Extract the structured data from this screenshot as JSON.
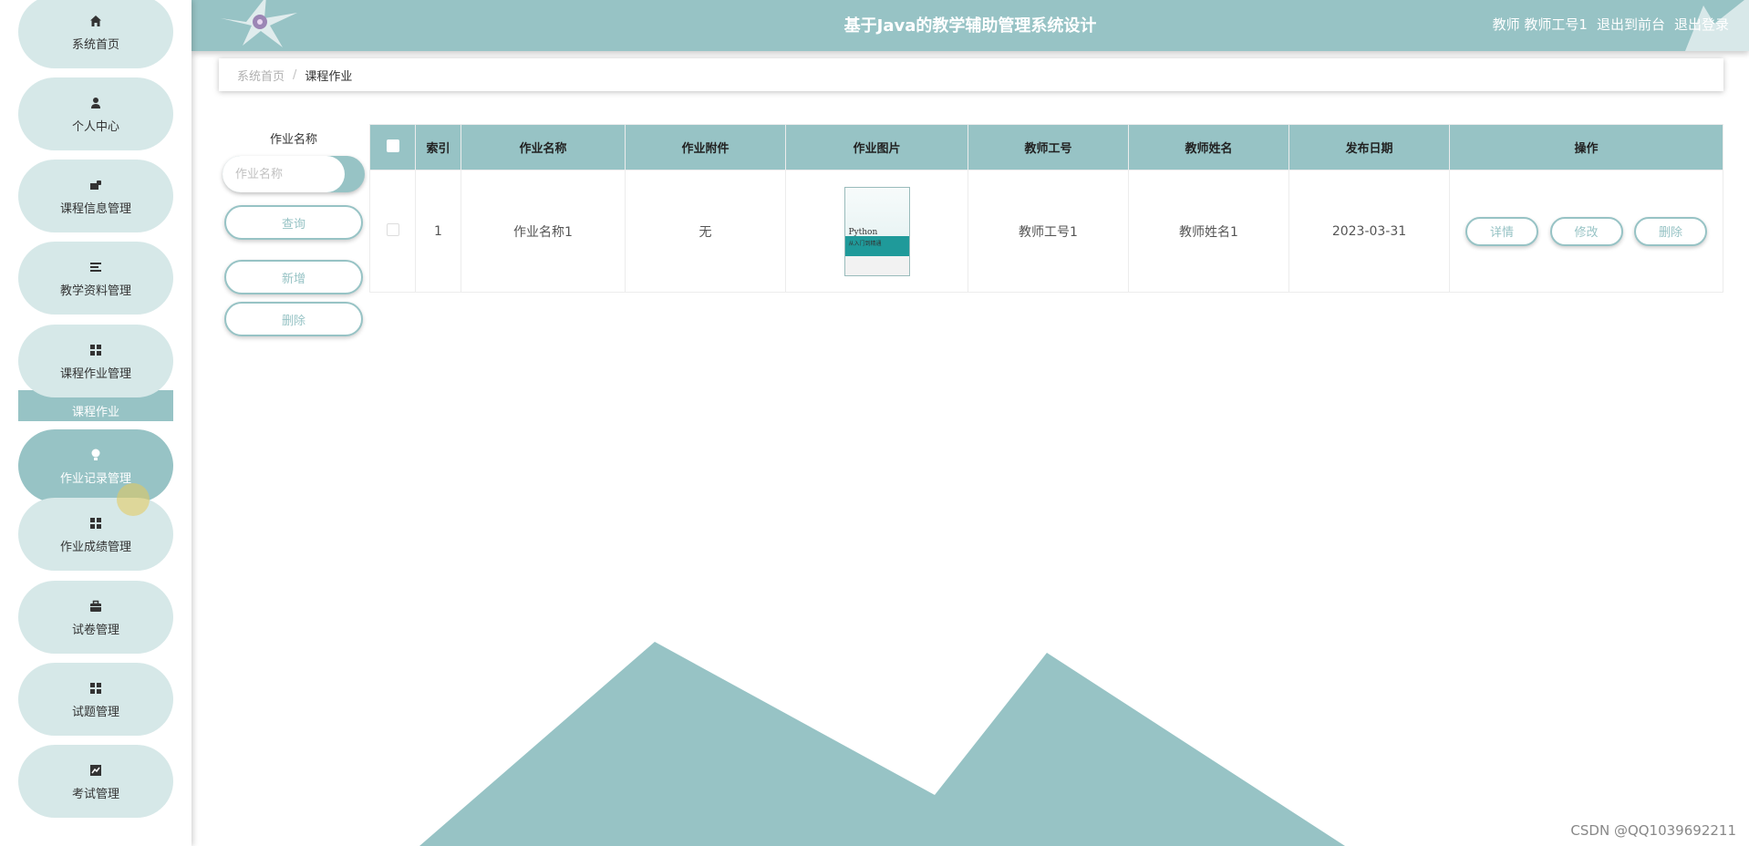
{
  "header": {
    "title": "基于Java的教学辅助管理系统设计",
    "user_role": "教师 教师工号1",
    "exit_front": "退出到前台",
    "logout": "退出登录"
  },
  "sidebar": {
    "items": [
      {
        "label": "系统首页",
        "icon": "home-icon"
      },
      {
        "label": "个人中心",
        "icon": "user-icon"
      },
      {
        "label": "课程信息管理",
        "icon": "course-icon"
      },
      {
        "label": "教学资料管理",
        "icon": "list-icon"
      },
      {
        "label": "课程作业管理",
        "icon": "grid-icon"
      },
      {
        "label": "作业记录管理",
        "icon": "bulb-icon"
      },
      {
        "label": "作业成绩管理",
        "icon": "grid-icon"
      },
      {
        "label": "试卷管理",
        "icon": "briefcase-icon"
      },
      {
        "label": "试题管理",
        "icon": "grid-icon"
      },
      {
        "label": "考试管理",
        "icon": "chart-icon"
      }
    ],
    "submenu_label": "课程作业"
  },
  "breadcrumb": {
    "home": "系统首页",
    "separator": "/",
    "current": "课程作业"
  },
  "search": {
    "label": "作业名称",
    "placeholder": "作业名称",
    "query_button": "查询",
    "add_button": "新增",
    "delete_button": "删除"
  },
  "table": {
    "headers": [
      "索引",
      "作业名称",
      "作业附件",
      "作业图片",
      "教师工号",
      "教师姓名",
      "发布日期",
      "操作"
    ],
    "rows": [
      {
        "index": "1",
        "name": "作业名称1",
        "attachment": "无",
        "image_title": "Python",
        "image_subtitle": "从入门到精通",
        "teacher_id": "教师工号1",
        "teacher_name": "教师姓名1",
        "date": "2023-03-31",
        "actions": {
          "detail": "详情",
          "edit": "修改",
          "delete": "删除"
        }
      }
    ]
  },
  "watermark": "CSDN @QQ1039692211",
  "colors": {
    "accent": "#97c3c5",
    "menu_bg": "#d6e8e8"
  }
}
